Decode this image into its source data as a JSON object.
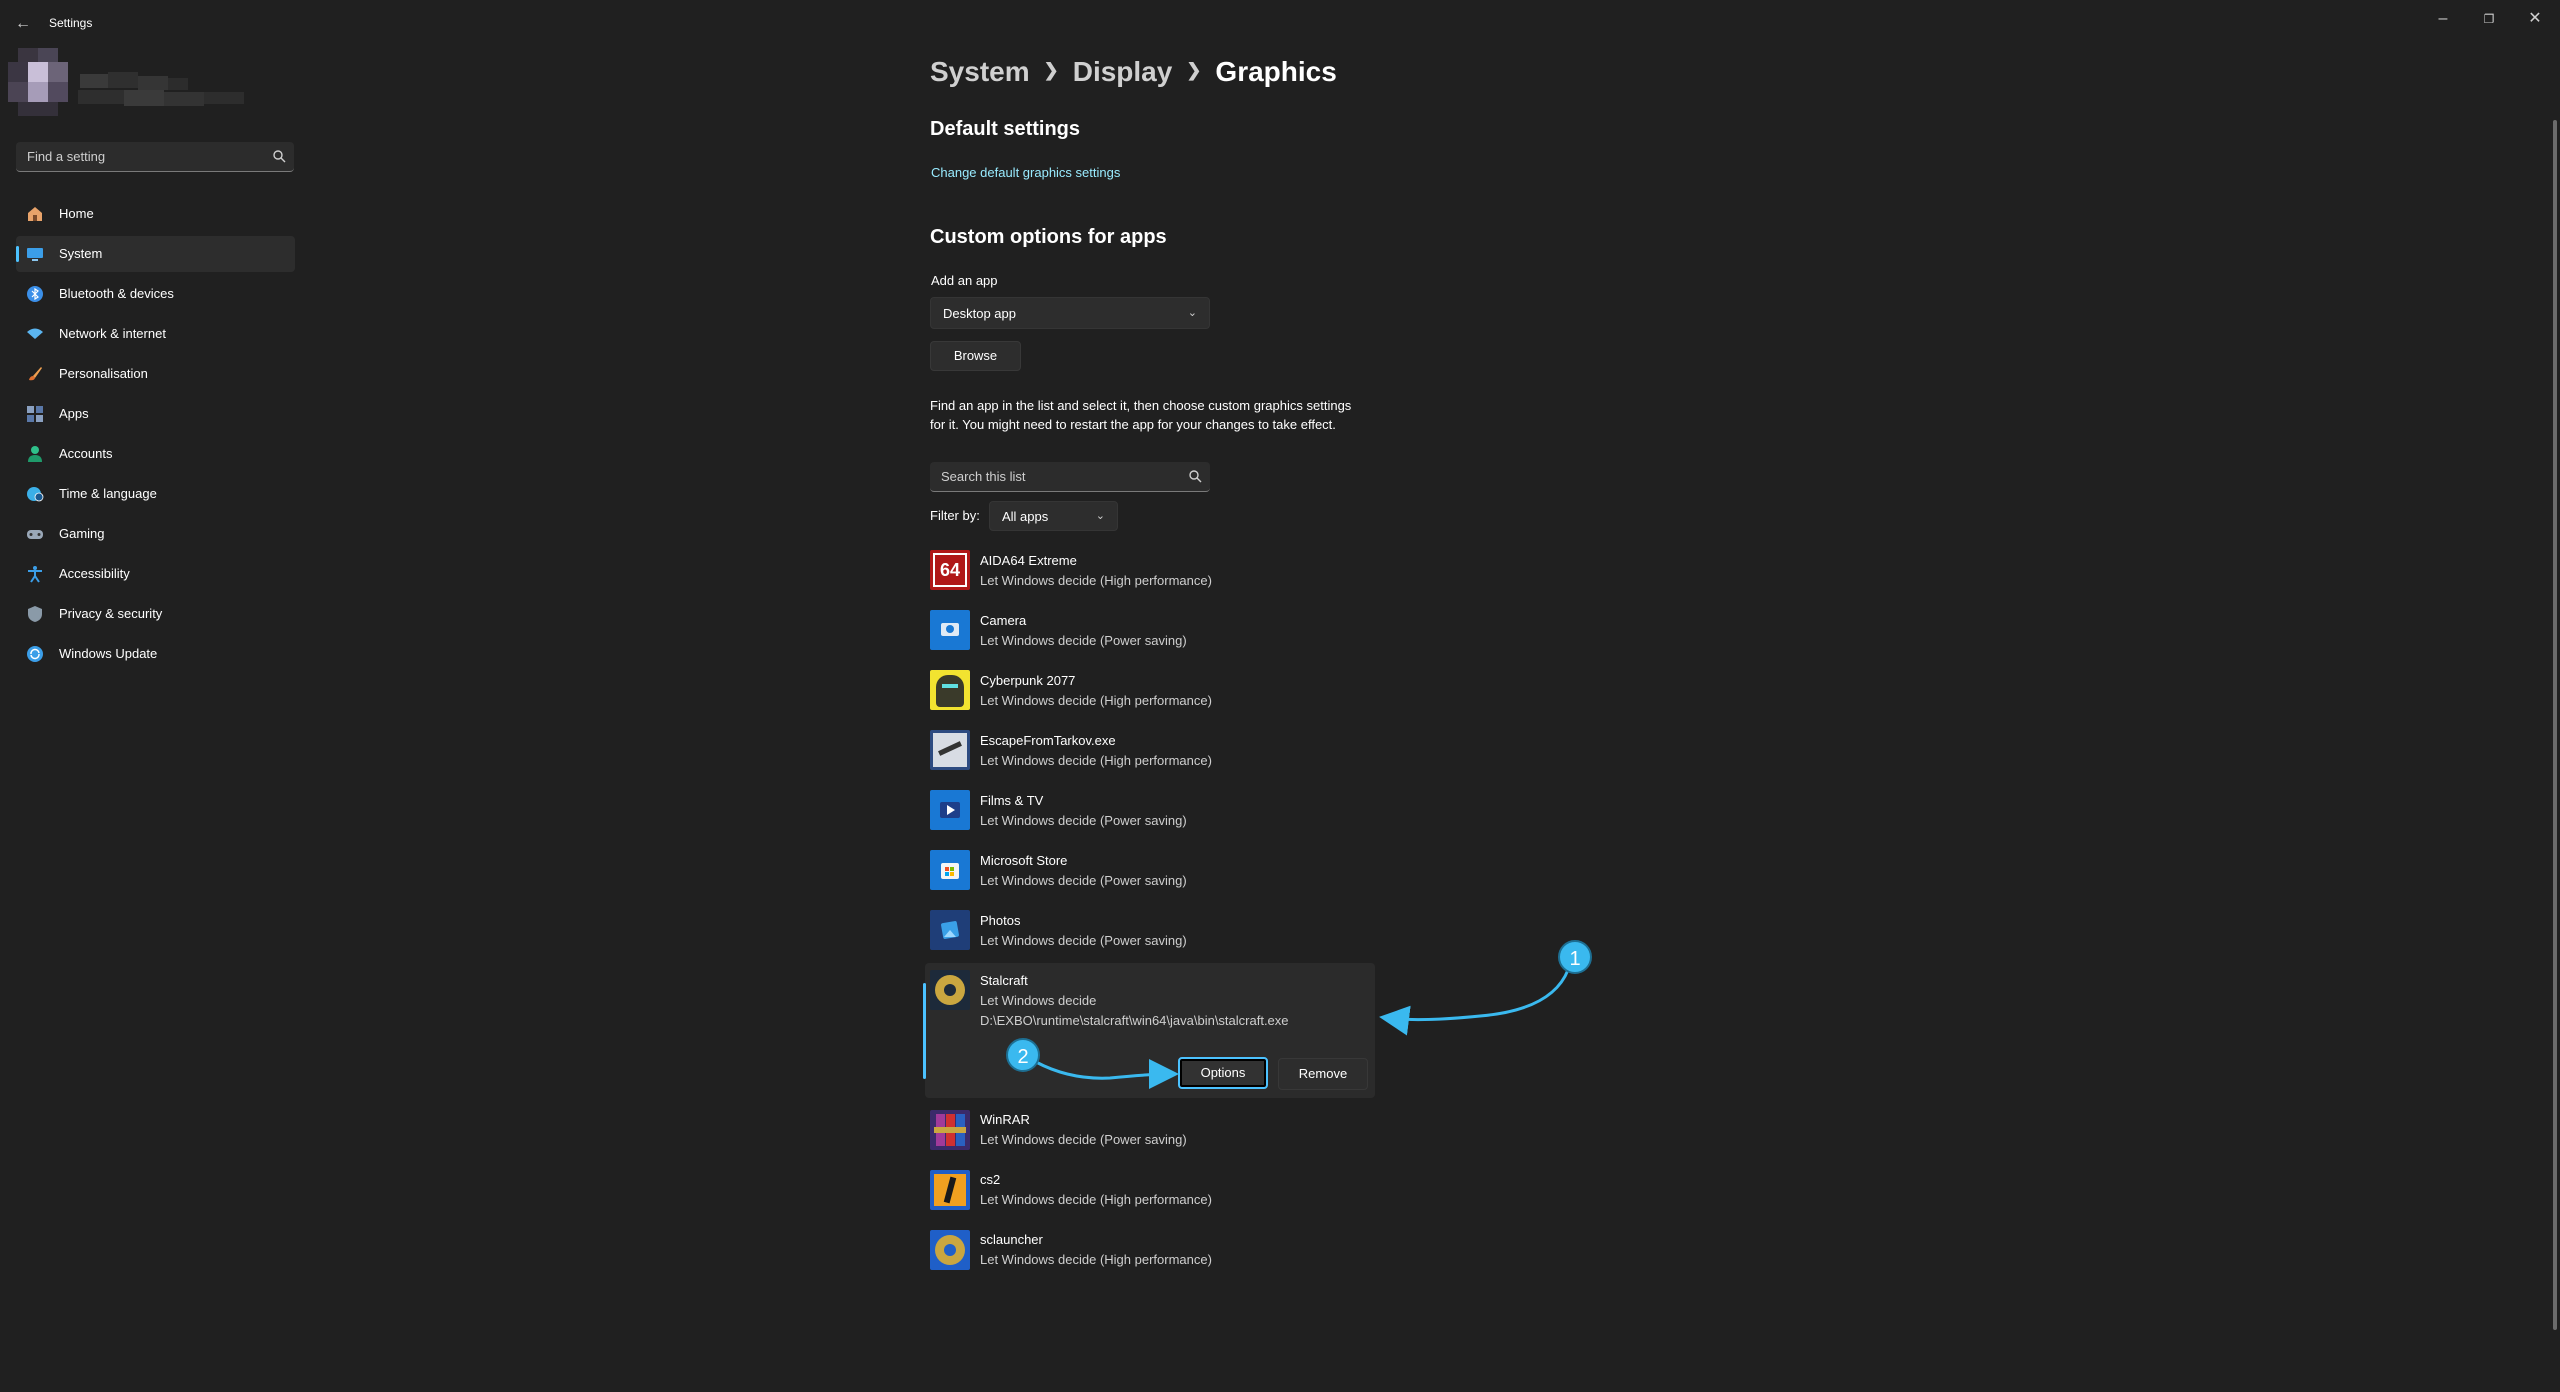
{
  "window": {
    "title": "Settings",
    "back_icon": "arrow-left-icon",
    "controls": [
      "minimize-icon",
      "restore-icon",
      "close-icon"
    ]
  },
  "sidebar": {
    "search_placeholder": "Find a setting",
    "items": [
      {
        "label": "Home",
        "icon": "home-icon",
        "color": "#e8a36a"
      },
      {
        "label": "System",
        "icon": "monitor-icon",
        "color": "#3b9ee8",
        "selected": true
      },
      {
        "label": "Bluetooth & devices",
        "icon": "bluetooth-icon",
        "color": "#3b8fe8"
      },
      {
        "label": "Network & internet",
        "icon": "wifi-icon",
        "color": "#5bb5f0"
      },
      {
        "label": "Personalisation",
        "icon": "brush-icon",
        "color": "#f0a050"
      },
      {
        "label": "Apps",
        "icon": "apps-icon",
        "color": "#8aa0c0"
      },
      {
        "label": "Accounts",
        "icon": "person-icon",
        "color": "#2fc08a"
      },
      {
        "label": "Time & language",
        "icon": "globe-clock-icon",
        "color": "#3bb0e8"
      },
      {
        "label": "Gaming",
        "icon": "gamepad-icon",
        "color": "#9aa8b8"
      },
      {
        "label": "Accessibility",
        "icon": "accessibility-icon",
        "color": "#3b9ee8"
      },
      {
        "label": "Privacy & security",
        "icon": "shield-icon",
        "color": "#8a9aa8"
      },
      {
        "label": "Windows Update",
        "icon": "update-icon",
        "color": "#3b9ee8"
      }
    ]
  },
  "breadcrumb": [
    "System",
    "Display",
    "Graphics"
  ],
  "default_settings": {
    "heading": "Default settings",
    "link": "Change default graphics settings"
  },
  "custom": {
    "heading": "Custom options for apps",
    "add_label": "Add an app",
    "app_type": "Desktop app",
    "browse": "Browse",
    "description": "Find an app in the list and select it, then choose custom graphics settings for it. You might need to restart the app for your changes to take effect.",
    "search_placeholder": "Search this list",
    "filter_label": "Filter by:",
    "filter_value": "All apps"
  },
  "apps": [
    {
      "name": "AIDA64 Extreme",
      "pref": "Let Windows decide (High performance)",
      "icon": "aida64-icon"
    },
    {
      "name": "Camera",
      "pref": "Let Windows decide (Power saving)",
      "icon": "camera-icon"
    },
    {
      "name": "Cyberpunk 2077",
      "pref": "Let Windows decide (High performance)",
      "icon": "cyberpunk-icon"
    },
    {
      "name": "EscapeFromTarkov.exe",
      "pref": "Let Windows decide (High performance)",
      "icon": "tarkov-icon"
    },
    {
      "name": "Films & TV",
      "pref": "Let Windows decide (Power saving)",
      "icon": "films-tv-icon"
    },
    {
      "name": "Microsoft Store",
      "pref": "Let Windows decide (Power saving)",
      "icon": "store-icon"
    },
    {
      "name": "Photos",
      "pref": "Let Windows decide (Power saving)",
      "icon": "photos-icon"
    },
    {
      "name": "Stalcraft",
      "pref": "Let Windows decide",
      "path": "D:\\EXBO\\runtime\\stalcraft\\win64\\java\\bin\\stalcraft.exe",
      "icon": "stalcraft-icon",
      "selected": true,
      "options": "Options",
      "remove": "Remove"
    },
    {
      "name": "WinRAR",
      "pref": "Let Windows decide (Power saving)",
      "icon": "winrar-icon"
    },
    {
      "name": "cs2",
      "pref": "Let Windows decide (High performance)",
      "icon": "cs2-icon"
    },
    {
      "name": "sclauncher",
      "pref": "Let Windows decide (High performance)",
      "icon": "sclauncher-icon"
    }
  ],
  "annotations": [
    "1",
    "2"
  ],
  "colors": {
    "accent": "#4cc2ff",
    "link": "#99ebff",
    "background": "#202020"
  }
}
